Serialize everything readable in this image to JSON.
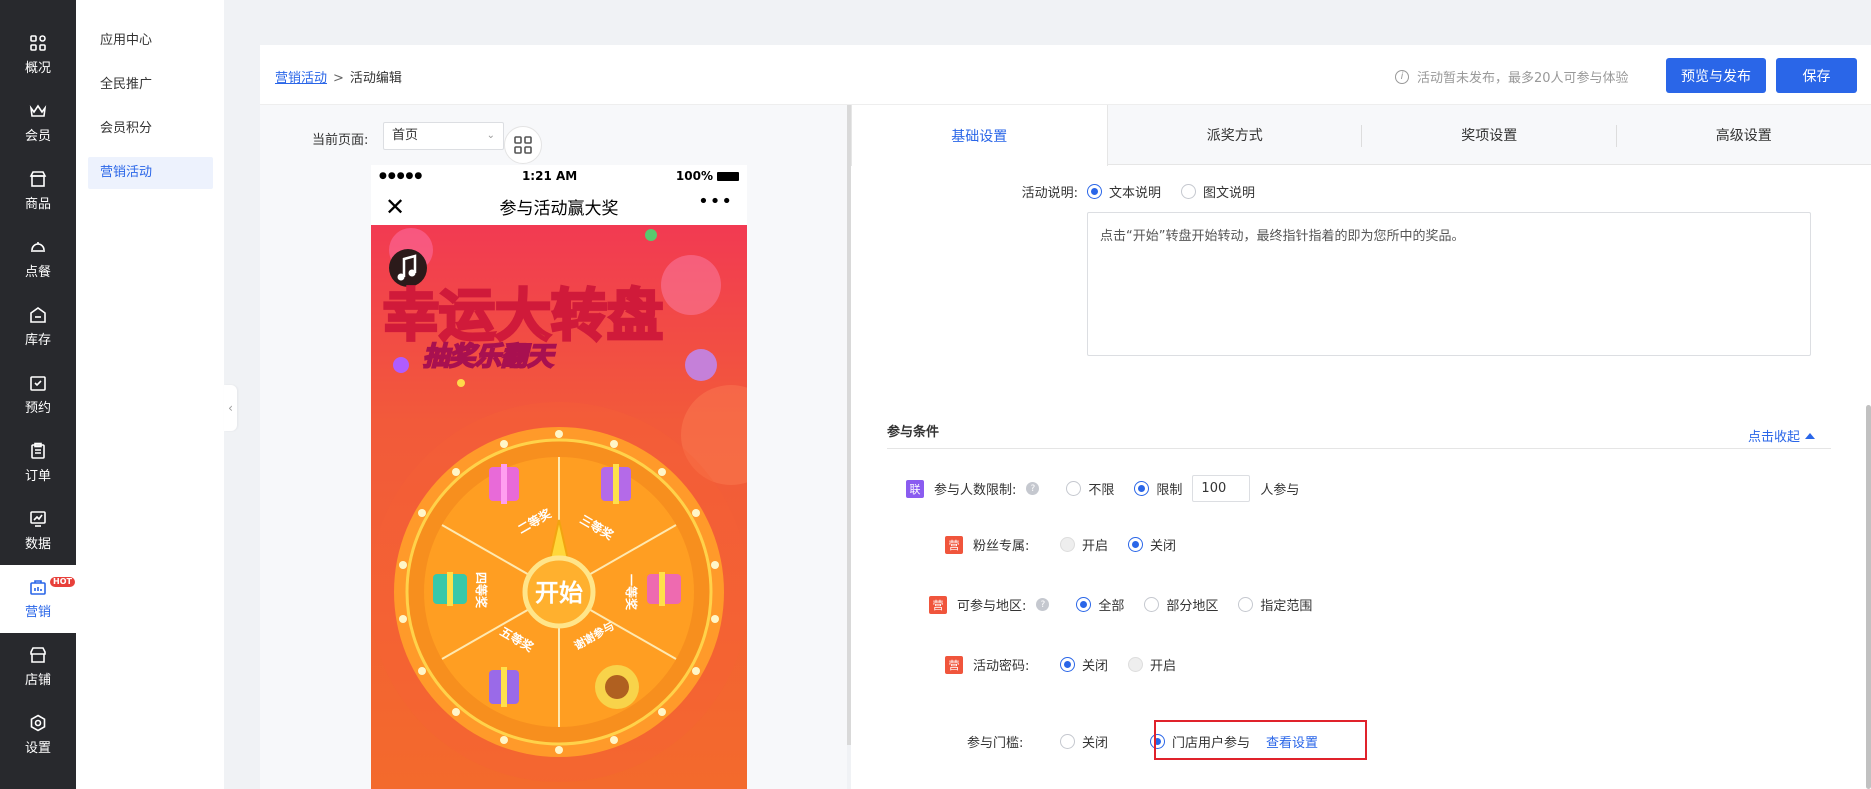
{
  "nav": {
    "items": [
      {
        "icon": "overview-icon",
        "label": "概况"
      },
      {
        "icon": "crown-icon",
        "label": "会员"
      },
      {
        "icon": "store-icon",
        "label": "商品"
      },
      {
        "icon": "cloche-icon",
        "label": "点餐"
      },
      {
        "icon": "inventory-icon",
        "label": "库存"
      },
      {
        "icon": "calendar-check-icon",
        "label": "预约"
      },
      {
        "icon": "clipboard-icon",
        "label": "订单"
      },
      {
        "icon": "chart-icon",
        "label": "数据"
      },
      {
        "icon": "marketing-bag-icon",
        "label": "营销",
        "badge": "HOT"
      },
      {
        "icon": "shop-icon",
        "label": "店铺"
      },
      {
        "icon": "gear-icon",
        "label": "设置"
      }
    ],
    "active_index": 8
  },
  "subnav": {
    "items": [
      "应用中心",
      "全民推广",
      "会员积分",
      "营销活动"
    ],
    "active_index": 3
  },
  "header": {
    "breadcrumb_link": "营销活动",
    "breadcrumb_sep": ">",
    "breadcrumb_current": "活动编辑",
    "notice": "活动暂未发布，最多20人可参与体验",
    "preview_publish_label": "预览与发布",
    "save_label": "保存"
  },
  "preview": {
    "page_label": "当前页面:",
    "page_value": "首页",
    "phone": {
      "carrier": "●●●●●",
      "time": "1:21 AM",
      "battery": "100%",
      "title": "参与活动赢大奖",
      "banner_title": "幸运大转盘",
      "banner_subtitle": "抽奖乐翻天",
      "wheel_center": "开始",
      "prizes": [
        "二等奖",
        "三等奖",
        "一等奖",
        "谢谢参与",
        "五等奖",
        "四等奖"
      ]
    }
  },
  "tabs": [
    "基础设置",
    "派奖方式",
    "奖项设置",
    "高级设置"
  ],
  "form": {
    "desc_label": "活动说明:",
    "desc_options": [
      "文本说明",
      "图文说明"
    ],
    "desc_text": "点击“开始”转盘开始转动，最终指针指着的即为您所中的奖品。",
    "section_title": "参与条件",
    "collapse_label": "点击收起",
    "people_limit": {
      "tag": "联",
      "label": "参与人数限制:",
      "options": [
        "不限",
        "限制"
      ],
      "value": "100",
      "suffix": "人参与"
    },
    "fans_only": {
      "tag": "营",
      "label": "粉丝专属:",
      "options": [
        "开启",
        "关闭"
      ]
    },
    "region": {
      "tag": "营",
      "label": "可参与地区:",
      "options": [
        "全部",
        "部分地区",
        "指定范围"
      ]
    },
    "password": {
      "tag": "营",
      "label": "活动密码:",
      "options": [
        "关闭",
        "开启"
      ]
    },
    "threshold": {
      "label": "参与门槛:",
      "options": [
        "关闭",
        "门店用户参与"
      ],
      "link": "查看设置"
    }
  },
  "colors": {
    "accent": "#2a66e8",
    "nav_bg": "#28292d",
    "tag_purple": "#8a5cf0",
    "tag_red": "#f0553c",
    "highlight": "#e0222b"
  }
}
